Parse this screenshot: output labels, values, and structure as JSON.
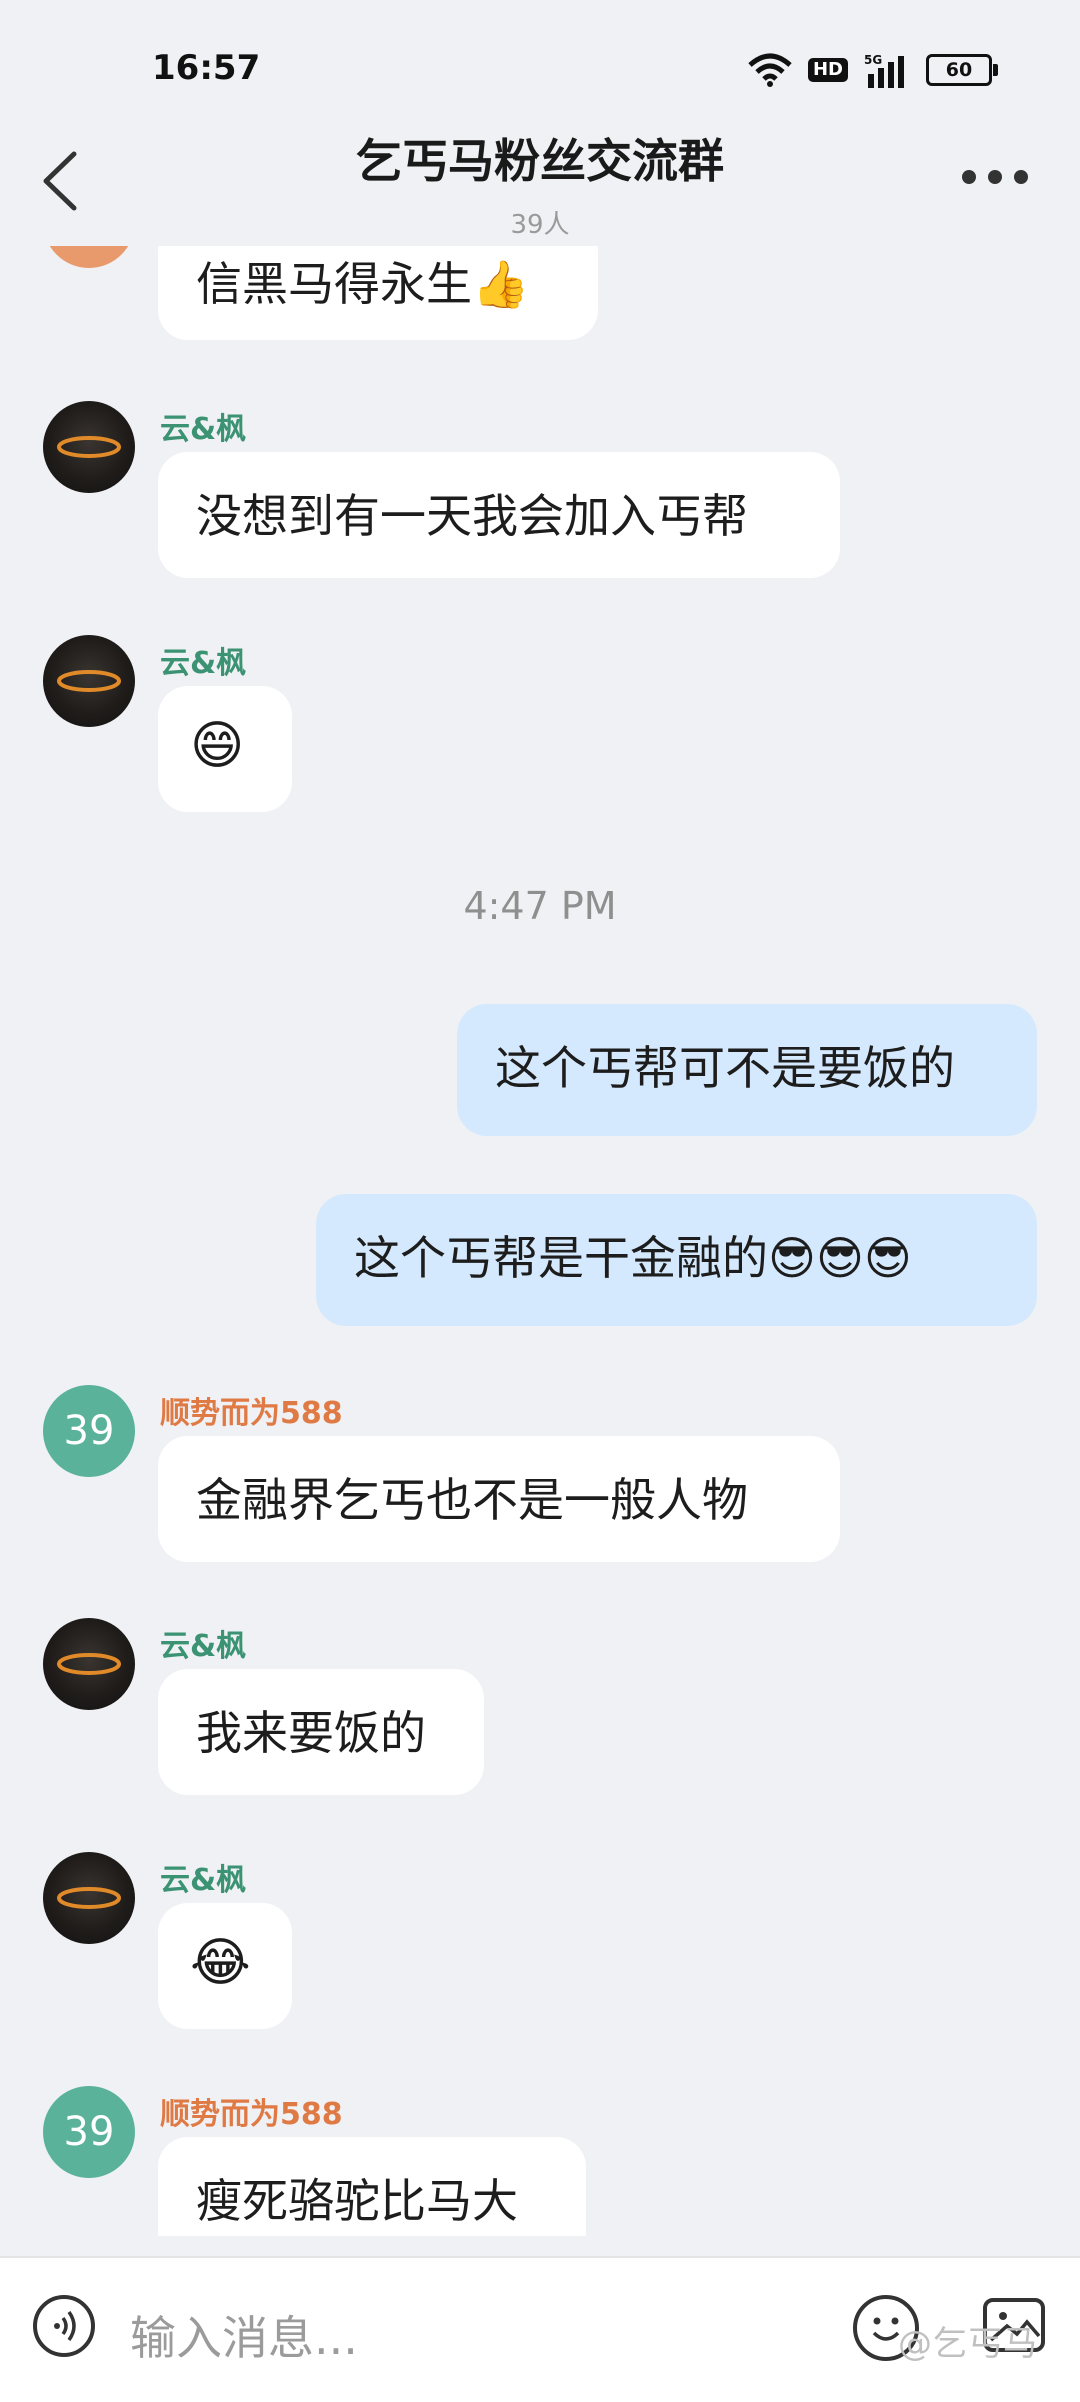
{
  "status_bar": {
    "time": "16:57",
    "network": "5G",
    "hd_badge": "HD",
    "battery": "60"
  },
  "header": {
    "title": "乞丐马粉丝交流群",
    "member_count": "39人"
  },
  "messages": [
    {
      "text": "信黑马得永生👍"
    },
    {
      "sender": "云&枫",
      "text": "没想到有一天我会加入丐帮"
    },
    {
      "sender": "云&枫",
      "text": "😄"
    },
    {
      "timestamp": "4:47 PM"
    },
    {
      "text": "这个丐帮可不是要饭的",
      "outgoing": true
    },
    {
      "text": "这个丐帮是干金融的😎😎😎",
      "outgoing": true
    },
    {
      "sender": "顺势而为588",
      "avatar_text": "39",
      "text": "金融界乞丐也不是一般人物"
    },
    {
      "sender": "云&枫",
      "text": "我来要饭的"
    },
    {
      "sender": "云&枫",
      "text": "😂"
    },
    {
      "sender": "顺势而为588",
      "avatar_text": "39",
      "text": "瘦死骆驼比马大"
    }
  ],
  "input": {
    "placeholder": "输入消息..."
  },
  "watermark": "@乞丐马",
  "colors": {
    "background": "#eff1f4",
    "outgoing_bubble": "#d4e9fd",
    "sender_green": "#3c9373",
    "sender_orange": "#e07a45",
    "avatar_teal": "#5ab29b"
  },
  "icons": [
    "wifi-icon",
    "signal-icon",
    "battery-icon",
    "back-icon",
    "more-icon",
    "voice-icon",
    "emoji-icon",
    "image-icon"
  ]
}
